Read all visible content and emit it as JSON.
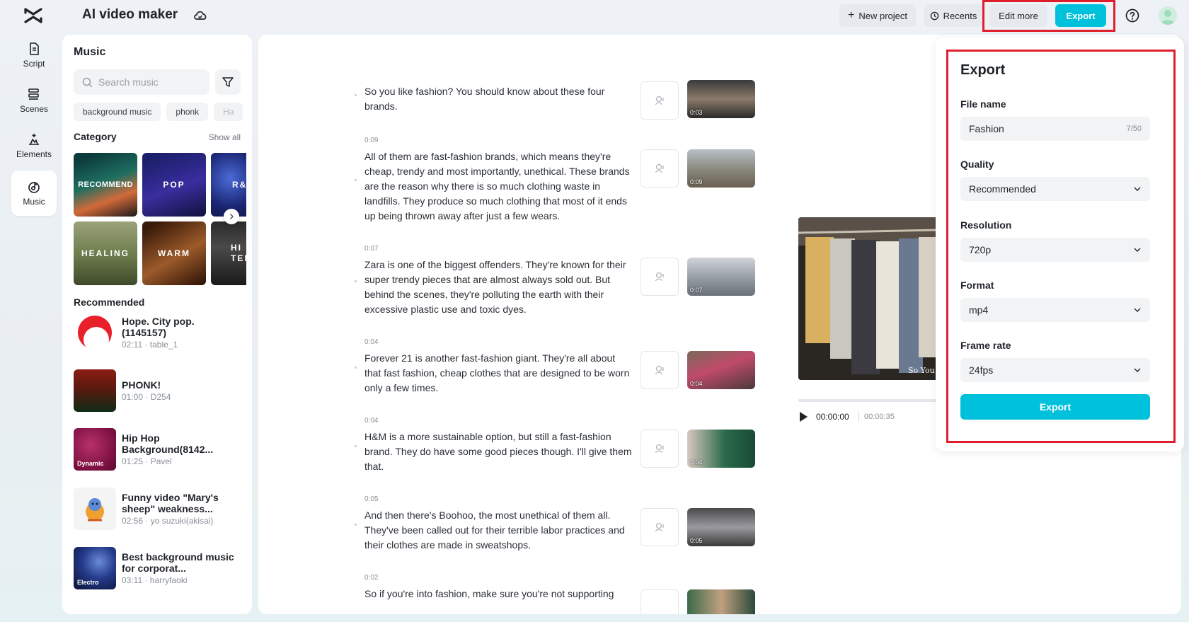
{
  "app": {
    "title": "AI video maker"
  },
  "topbar": {
    "new_project": "New project",
    "recents": "Recents",
    "edit_more": "Edit more",
    "export": "Export"
  },
  "rail": [
    {
      "label": "Script",
      "icon": "script-icon"
    },
    {
      "label": "Scenes",
      "icon": "scenes-icon"
    },
    {
      "label": "Elements",
      "icon": "elements-icon"
    },
    {
      "label": "Music",
      "icon": "music-icon",
      "active": true
    }
  ],
  "music": {
    "title": "Music",
    "search_placeholder": "Search music",
    "chips": [
      "background music",
      "phonk",
      "Ha"
    ],
    "category_title": "Category",
    "show_all": "Show all",
    "categories": [
      "RECOMMEND",
      "POP",
      "R&",
      "HEALING",
      "WARM",
      "HI TEM"
    ],
    "recommended_title": "Recommended",
    "tracks": [
      {
        "name": "Hope. City pop.(1145157)",
        "meta": "02:11 · table_1"
      },
      {
        "name": "PHONK!",
        "meta": "01:00 · D254"
      },
      {
        "name": "Hip Hop Background(8142...",
        "meta": "01:25 · Pavel",
        "badge": "Dynamic"
      },
      {
        "name": "Funny video \"Mary's sheep\" weakness...",
        "meta": "02:56 · yo suzuki(akisai)"
      },
      {
        "name": "Best background music for corporat...",
        "meta": "03:11 · harryfaoki",
        "badge": "Electro"
      }
    ]
  },
  "scenes": [
    {
      "time": "",
      "text": "So you like fashion? You should know about these four brands.",
      "thumb_time": "0:03"
    },
    {
      "time": "0:09",
      "text": "All of them are fast-fashion brands, which means they're cheap, trendy and most importantly, unethical. These brands are the reason why there is so much clothing waste in landfills. They produce so much clothing that most of it ends up being thrown away after just a few wears.",
      "thumb_time": "0:09"
    },
    {
      "time": "0:07",
      "text": "Zara is one of the biggest offenders. They're known for their super trendy pieces that are almost always sold out. But behind the scenes, they're polluting the earth with their excessive plastic use and toxic dyes.",
      "thumb_time": "0:07"
    },
    {
      "time": "0:04",
      "text": "Forever 21 is another fast-fashion giant. They're all about that fast fashion, cheap clothes that are designed to be worn only a few times.",
      "thumb_time": "0:04"
    },
    {
      "time": "0:04",
      "text": "H&M is a more sustainable option, but still a fast-fashion brand. They do have some good pieces though. I'll give them that.",
      "thumb_time": "0:04"
    },
    {
      "time": "0:05",
      "text": "And then there's Boohoo, the most unethical of them all. They've been called out for their terrible labor practices and their clothes are made in sweatshops.",
      "thumb_time": "0:05"
    },
    {
      "time": "0:02",
      "text": "So if you're into fashion, make sure you're not supporting",
      "thumb_time": ""
    }
  ],
  "preview": {
    "caption": "So You Li",
    "current_time": "00:00:00",
    "total_time": "00:00:35"
  },
  "export_panel": {
    "title": "Export",
    "file_name_label": "File name",
    "file_name_value": "Fashion",
    "file_name_counter": "7/50",
    "quality_label": "Quality",
    "quality_value": "Recommended",
    "resolution_label": "Resolution",
    "resolution_value": "720p",
    "format_label": "Format",
    "format_value": "mp4",
    "frame_rate_label": "Frame rate",
    "frame_rate_value": "24fps",
    "export_button": "Export"
  },
  "colors": {
    "accent": "#00c1dc",
    "highlight": "#e01e2b"
  }
}
